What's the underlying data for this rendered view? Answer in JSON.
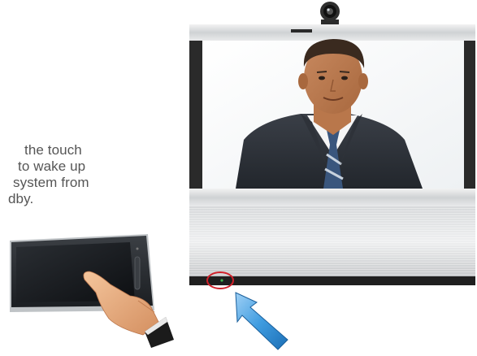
{
  "instruction": {
    "lines": [
      "the touch",
      "to wake up",
      "system from",
      "dby."
    ]
  },
  "icons": {
    "touch_panel": "touch-panel-icon",
    "hand": "pointing-hand-icon",
    "arrow": "blue-arrow-icon",
    "highlight": "red-circle-highlight-icon",
    "camera": "camera-icon"
  },
  "colors": {
    "highlight_ring": "#d0202a",
    "arrow_blue": "#2f8fd8"
  }
}
